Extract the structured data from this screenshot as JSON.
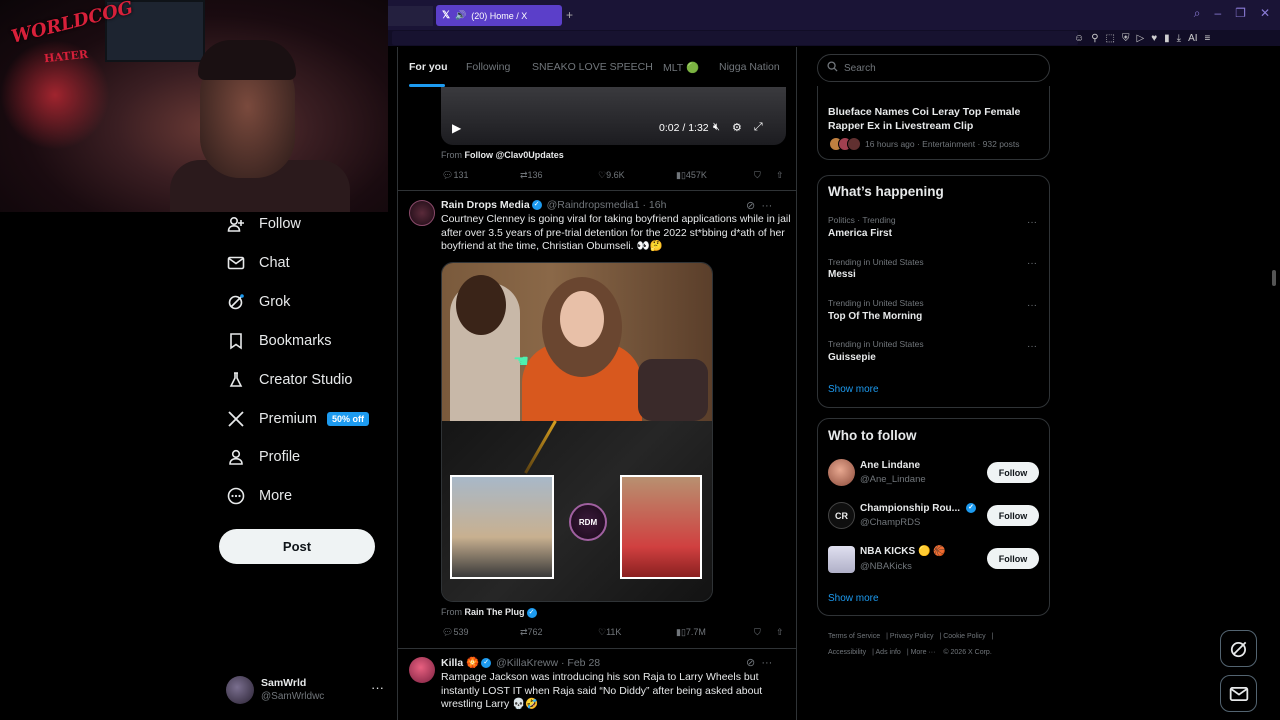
{
  "browser": {
    "tab_title": "(20) Home / X",
    "new_tab": "+",
    "extensions_label": "AI"
  },
  "webcam": {
    "overlay_logo": "WORLDCOG",
    "overlay_sub": "HATER"
  },
  "nav": {
    "items": [
      {
        "label": "Follow",
        "icon": "add-person-icon"
      },
      {
        "label": "Chat",
        "icon": "mail-icon"
      },
      {
        "label": "Grok",
        "icon": "grok-icon"
      },
      {
        "label": "Bookmarks",
        "icon": "bookmark-icon"
      },
      {
        "label": "Creator Studio",
        "icon": "flask-icon"
      },
      {
        "label": "Premium",
        "icon": "x-logo-icon"
      },
      {
        "label": "Profile",
        "icon": "person-icon"
      },
      {
        "label": "More",
        "icon": "more-circle-icon"
      }
    ],
    "premium_badge": "50% off",
    "post_label": "Post"
  },
  "user": {
    "name": "SamWrld",
    "handle": "@SamWrldwc"
  },
  "feed": {
    "tabs": [
      "For you",
      "Following",
      "SNEAKO LOVE SPEECH",
      "MLT 🟢",
      "Nigga Nation"
    ],
    "video_time": "0:02 / 1:32",
    "post1": {
      "from_prefix": "From",
      "from_source": "Follow @Clav0Updates",
      "stats": {
        "replies": "131",
        "reposts": "136",
        "likes": "9.6K",
        "views": "457K"
      }
    },
    "post2": {
      "name": "Rain Drops Media",
      "handle": "@Raindropsmedia1 · 16h",
      "text": "Courtney Clenney is going viral for taking boyfriend applications while in jail after over 3.5 years of pre-trial detention for the 2022 st*bbing d*ath of her boyfriend at the time, Christian Obumseli. 👀🤔",
      "media_logo": "RDM",
      "from_prefix": "From",
      "from_source": "Rain The Plug",
      "stats": {
        "replies": "539",
        "reposts": "762",
        "likes": "11K",
        "views": "7.7M"
      }
    },
    "post3": {
      "name": "Killa 🏵️",
      "handle": "@KillaKreww · Feb 28",
      "text": "Rampage Jackson was introducing his son Raja to Larry Wheels but instantly LOST IT when Raja said “No Diddy” after being asked about wrestling Larry 💀🤣"
    }
  },
  "search": {
    "placeholder": "Search"
  },
  "trend_top": {
    "title": "Blueface Names Coi Leray Top Female Rapper Ex in Livestream Clip",
    "meta": "16 hours ago · Entertainment · 932 posts"
  },
  "happening": {
    "title": "What’s happening",
    "trends": [
      {
        "meta": "Politics · Trending",
        "name": "America First"
      },
      {
        "meta": "Trending in United States",
        "name": "Messi"
      },
      {
        "meta": "Trending in United States",
        "name": "Top Of The Morning"
      },
      {
        "meta": "Trending in United States",
        "name": "Guissepie"
      }
    ],
    "show_more": "Show more"
  },
  "who_to_follow": {
    "title": "Who to follow",
    "accounts": [
      {
        "name": "Ane Lindane",
        "handle": "@Ane_Lindane",
        "button": "Follow"
      },
      {
        "name": "Championship Rou...",
        "handle": "@ChampRDS",
        "button": "Follow"
      },
      {
        "name": "NBA KICKS 🟡 🏀",
        "handle": "@NBAKicks",
        "button": "Follow"
      }
    ],
    "show_more": "Show more"
  },
  "footer": {
    "links": [
      "Terms of Service",
      "Privacy Policy",
      "Cookie Policy",
      "Accessibility",
      "Ads info",
      "More ···",
      "© 2026 X Corp."
    ]
  },
  "colors": {
    "accent": "#1d9bf0",
    "tab_active": "#5b3fc9",
    "background": "#000000"
  }
}
